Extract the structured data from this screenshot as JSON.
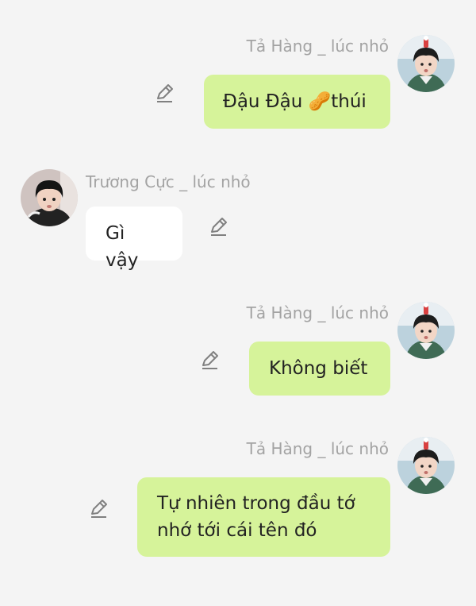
{
  "messages": [
    {
      "side": "right",
      "sender": "Tả Hàng _ lúc nhỏ",
      "text": "Đậu Đậu 🥜thúi",
      "avatar": "avatar-boy-green-jacket",
      "bubble_color": "#d6f39a"
    },
    {
      "side": "left",
      "sender": "Trương Cực _ lúc nhỏ",
      "text": "Gì vậy",
      "avatar": "avatar-boy-dark-shirt",
      "bubble_color": "#ffffff"
    },
    {
      "side": "right",
      "sender": "Tả Hàng _ lúc nhỏ",
      "text": "Không biết",
      "avatar": "avatar-boy-green-jacket",
      "bubble_color": "#d6f39a"
    },
    {
      "side": "right",
      "sender": "Tả Hàng _ lúc nhỏ",
      "text": "Tự nhiên trong đầu tớ\nnhớ tới cái tên đó",
      "avatar": "avatar-boy-green-jacket",
      "bubble_color": "#d6f39a"
    }
  ],
  "icons": {
    "edit": "pencil-edit-icon"
  },
  "colors": {
    "background": "#f4f4f4",
    "name_text": "#a3a3a3",
    "green_bubble": "#d6f39a",
    "white_bubble": "#ffffff"
  }
}
